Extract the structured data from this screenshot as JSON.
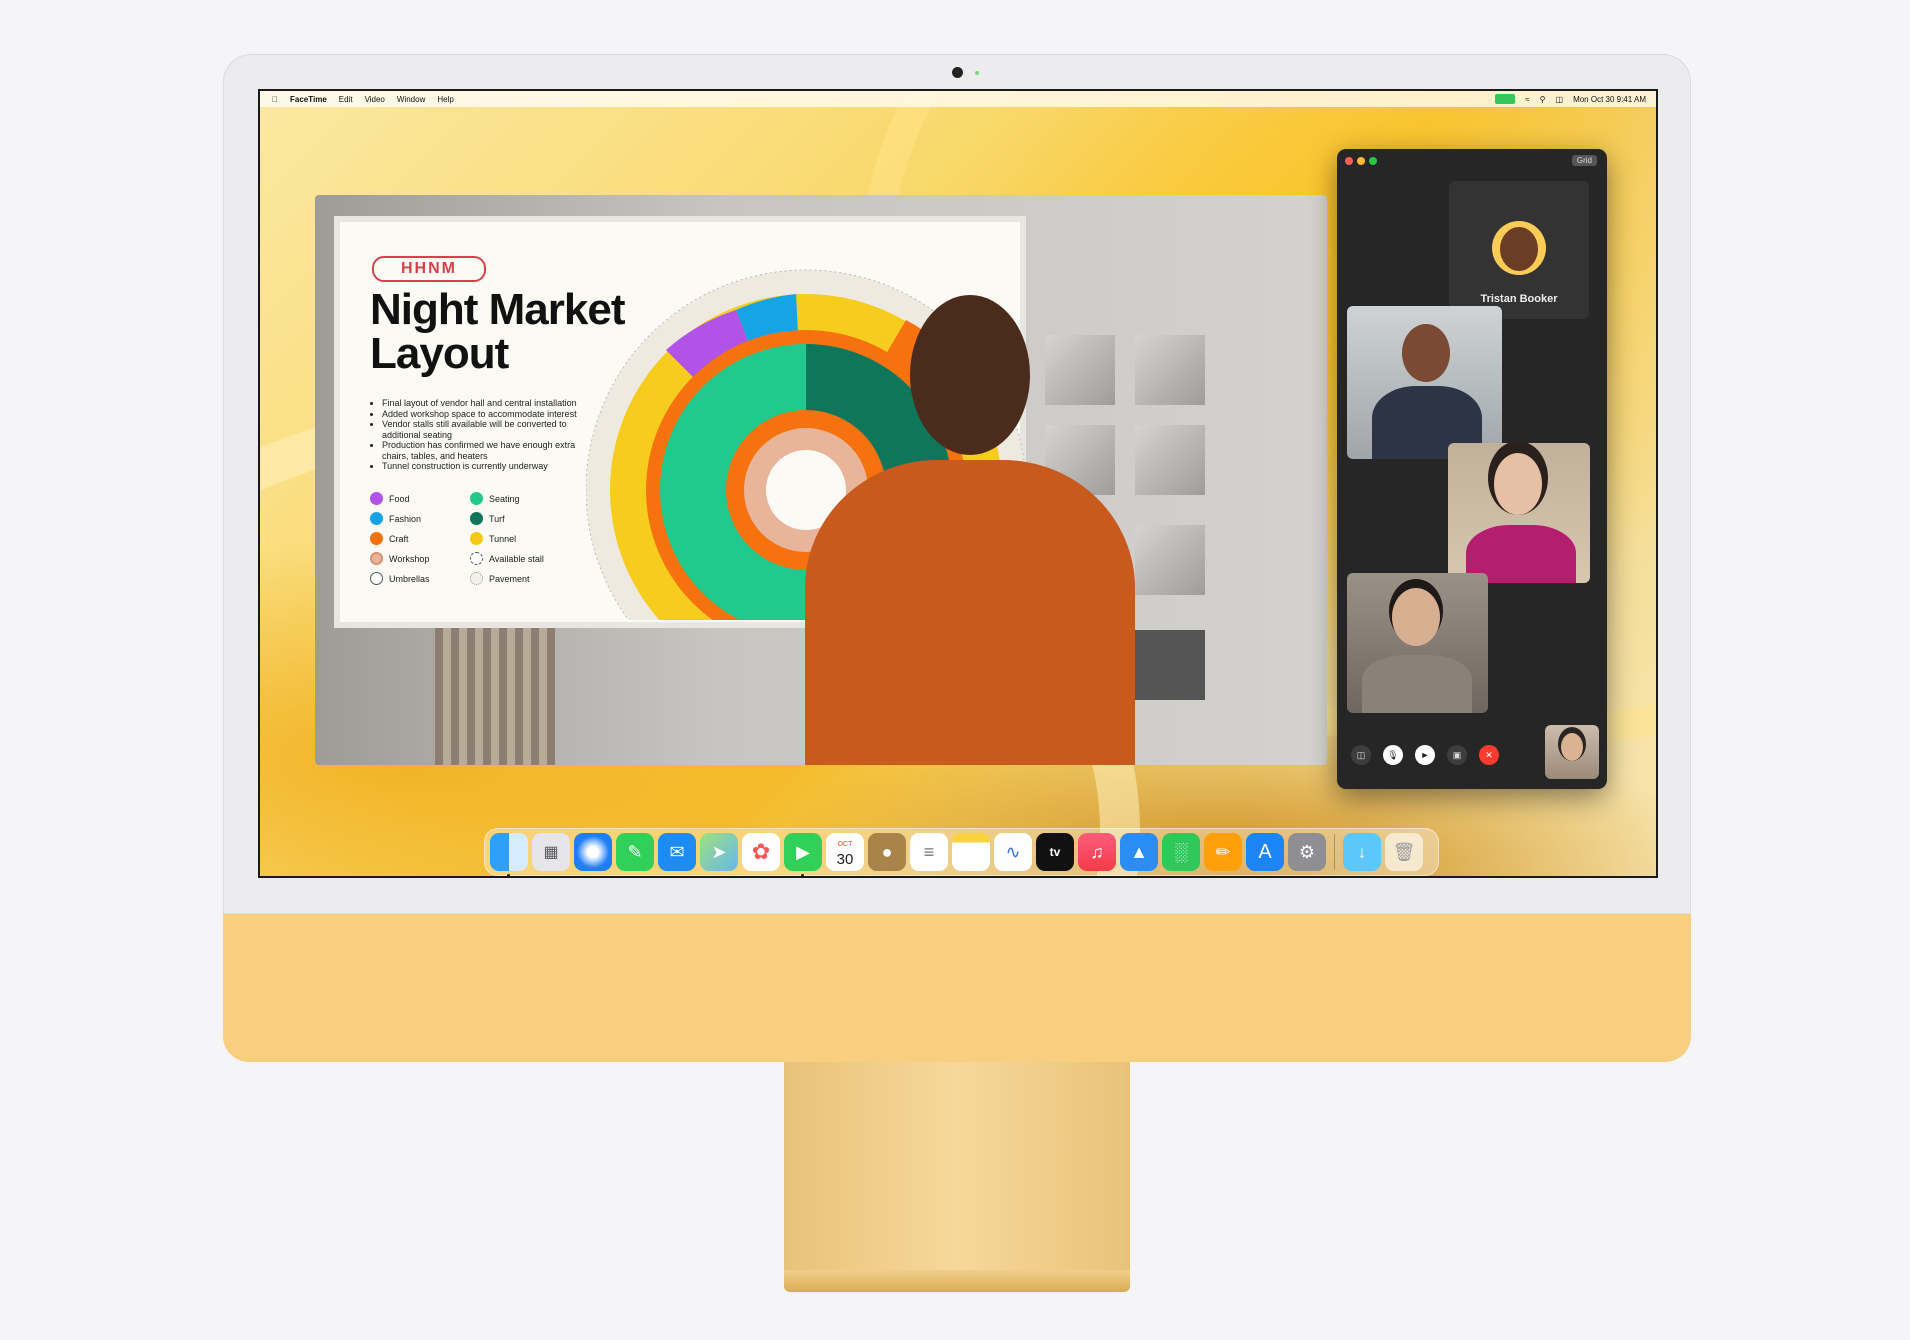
{
  "menubar": {
    "app": "FaceTime",
    "items": [
      "Edit",
      "Video",
      "Window",
      "Help"
    ],
    "clock": "Mon Oct 30  9:41 AM"
  },
  "poster": {
    "logo": "HHNM",
    "title": "Night Market Layout",
    "bullets": [
      "Final layout of vendor hall and central installation",
      "Added workshop space to accommodate interest",
      "Vendor stalls still available will be converted to additional seating",
      "Production has confirmed we have enough extra chairs, tables, and heaters",
      "Tunnel construction is currently underway"
    ],
    "legend": [
      {
        "label": "Food",
        "color": "#b153e6"
      },
      {
        "label": "Seating",
        "color": "#22c98c"
      },
      {
        "label": "Fashion",
        "color": "#17a4e6"
      },
      {
        "label": "Turf",
        "color": "#10765b"
      },
      {
        "label": "Craft",
        "color": "#f5720f"
      },
      {
        "label": "Tunnel",
        "color": "#f7c814"
      },
      {
        "label": "Workshop",
        "color": "#e8b59a"
      },
      {
        "label": "Available stall",
        "color": "#cccccc"
      },
      {
        "label": "Umbrellas",
        "color": "#ffffff"
      },
      {
        "label": "Pavement",
        "color": "#eeeeee"
      }
    ]
  },
  "facetime": {
    "grid_button": "Grid",
    "caller_name": "Tristan Booker"
  },
  "dock": {
    "calendar_month": "OCT",
    "calendar_day": "30",
    "tv_label": "tv"
  }
}
